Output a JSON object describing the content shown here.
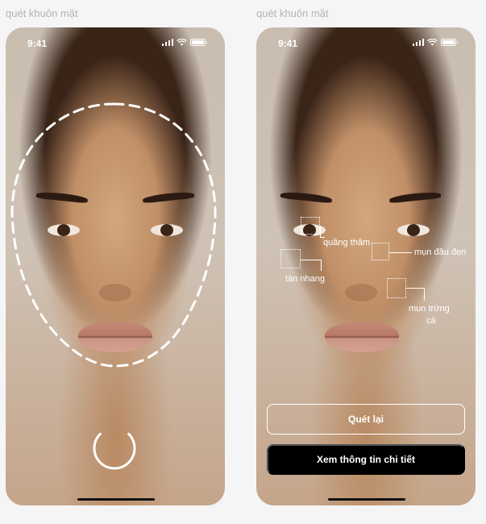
{
  "screens": [
    {
      "label": "quét khuôn mặt",
      "status_time": "9:41"
    },
    {
      "label": "quét khuôn mặt",
      "status_time": "9:41",
      "skin_tags": {
        "dark_circles": "quầng thâm",
        "blackheads": "mụn đầu đen",
        "freckles": "tàn nhang",
        "acne_line1": "mụn trứng",
        "acne_line2": "cá"
      },
      "buttons": {
        "rescan": "Quét lại",
        "details": "Xem thông tin chi tiết"
      }
    }
  ],
  "icons": [
    "signal-icon",
    "wifi-icon",
    "battery-icon",
    "loading-spinner-icon"
  ],
  "colors": {
    "background": "#f5f5f5",
    "label": "#b3b3b3",
    "overlay": "#ffffff",
    "primary_button": "#000000"
  }
}
